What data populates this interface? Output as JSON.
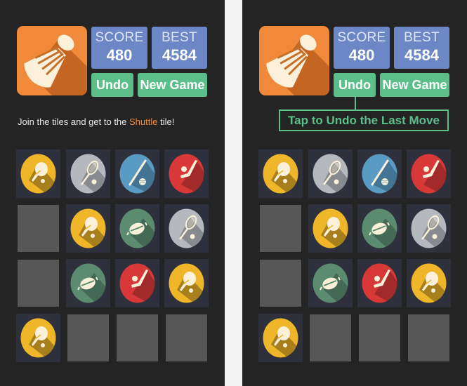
{
  "colors": {
    "app_bg": "#242424",
    "page_bg": "#f4f4f4",
    "logo_orange": "#f0893a",
    "stat_blue": "#6b87c5",
    "button_green": "#5cbf8a",
    "highlight_orange": "#f0893a",
    "filled_tile": "#2e303c",
    "empty_tile": "#575757"
  },
  "tile_types": {
    "ping-pong": {
      "color": "#efb62a",
      "icon": "ping-pong-paddle-icon"
    },
    "tennis": {
      "color": "#b5b9be",
      "icon": "tennis-racket-icon"
    },
    "baseball": {
      "color": "#5a9bc4",
      "icon": "baseball-bat-icon"
    },
    "hockey": {
      "color": "#d93838",
      "icon": "hockey-stick-icon"
    },
    "football": {
      "color": "#5b8c70",
      "icon": "american-football-icon"
    }
  },
  "panels": [
    {
      "id": "left",
      "score": {
        "label": "SCORE",
        "value": "480"
      },
      "best": {
        "label": "BEST",
        "value": "4584"
      },
      "buttons": {
        "undo": "Undo",
        "new_game": "New Game"
      },
      "tagline": {
        "before": "Join the tiles and get to the ",
        "highlight": "Shuttle",
        "after": " tile!"
      },
      "callout": null,
      "grid": [
        [
          "ping-pong",
          "tennis",
          "baseball",
          "hockey"
        ],
        [
          "",
          "ping-pong",
          "football",
          "tennis"
        ],
        [
          "",
          "football",
          "hockey",
          "ping-pong"
        ],
        [
          "ping-pong",
          "",
          "",
          ""
        ]
      ]
    },
    {
      "id": "right",
      "score": {
        "label": "SCORE",
        "value": "480"
      },
      "best": {
        "label": "BEST",
        "value": "4584"
      },
      "buttons": {
        "undo": "Undo",
        "new_game": "New Game"
      },
      "tagline": null,
      "callout": "Tap to Undo the Last Move",
      "grid": [
        [
          "ping-pong",
          "tennis",
          "baseball",
          "hockey"
        ],
        [
          "",
          "ping-pong",
          "football",
          "tennis"
        ],
        [
          "",
          "football",
          "hockey",
          "ping-pong"
        ],
        [
          "ping-pong",
          "",
          "",
          ""
        ]
      ]
    }
  ]
}
